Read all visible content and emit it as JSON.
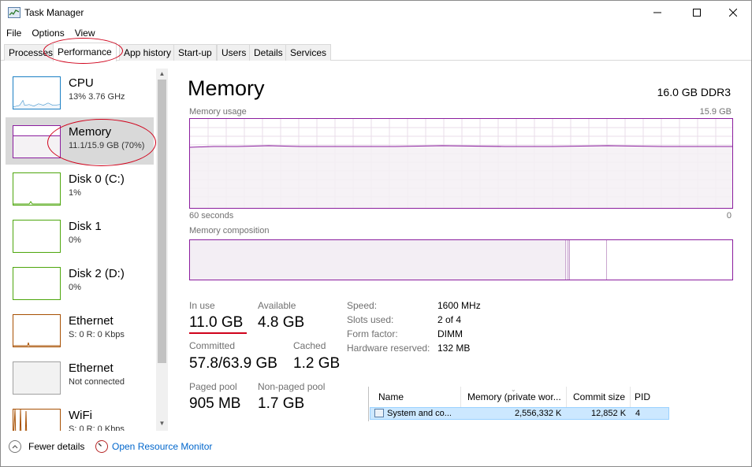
{
  "window": {
    "title": "Task Manager"
  },
  "menu": [
    "File",
    "Options",
    "View"
  ],
  "tabs": [
    "Processes",
    "Performance",
    "App history",
    "Start-up",
    "Users",
    "Details",
    "Services"
  ],
  "sidebar": {
    "items": [
      {
        "title": "CPU",
        "sub": "13% 3.76 GHz",
        "color": "#1b7fc4"
      },
      {
        "title": "Memory",
        "sub": "11.1/15.9 GB (70%)",
        "color": "#8b1d9e"
      },
      {
        "title": "Disk 0 (C:)",
        "sub": "1%",
        "color": "#4da60c"
      },
      {
        "title": "Disk 1",
        "sub": "0%",
        "color": "#4da60c"
      },
      {
        "title": "Disk 2 (D:)",
        "sub": "0%",
        "color": "#4da60c"
      },
      {
        "title": "Ethernet",
        "sub": "S: 0 R: 0 Kbps",
        "color": "#a74f01"
      },
      {
        "title": "Ethernet",
        "sub": "Not connected",
        "color": "#a0a0a0"
      },
      {
        "title": "WiFi",
        "sub": "S: 0 R: 0 Kbps",
        "color": "#a74f01"
      }
    ]
  },
  "main": {
    "title": "Memory",
    "spec": "16.0 GB DDR3",
    "graph": {
      "label": "Memory usage",
      "max": "15.9 GB",
      "time_left": "60 seconds",
      "time_right": "0",
      "usage_fraction": 0.7
    },
    "composition_label": "Memory composition",
    "stats": {
      "in_use_label": "In use",
      "in_use": "11.0 GB",
      "available_label": "Available",
      "available": "4.8 GB",
      "committed_label": "Committed",
      "committed": "57.8/63.9 GB",
      "cached_label": "Cached",
      "cached": "1.2 GB",
      "paged_label": "Paged pool",
      "paged": "905 MB",
      "nonpaged_label": "Non-paged pool",
      "nonpaged": "1.7 GB"
    },
    "specs": {
      "speed_label": "Speed:",
      "speed": "1600 MHz",
      "slots_label": "Slots used:",
      "slots": "2 of 4",
      "form_label": "Form factor:",
      "form": "DIMM",
      "reserved_label": "Hardware reserved:",
      "reserved": "132 MB"
    }
  },
  "process_table": {
    "headers": [
      "Name",
      "Memory (private wor...",
      "Commit size",
      "PID"
    ],
    "row": {
      "name": "System and co...",
      "memory": "2,556,332 K",
      "commit": "12,852 K",
      "pid": "4"
    }
  },
  "footer": {
    "fewer_details": "Fewer details",
    "resource_monitor": "Open Resource Monitor"
  },
  "colors": {
    "memory": "#8b1d9e",
    "annotation": "#d0021b",
    "link": "#0066cc"
  }
}
